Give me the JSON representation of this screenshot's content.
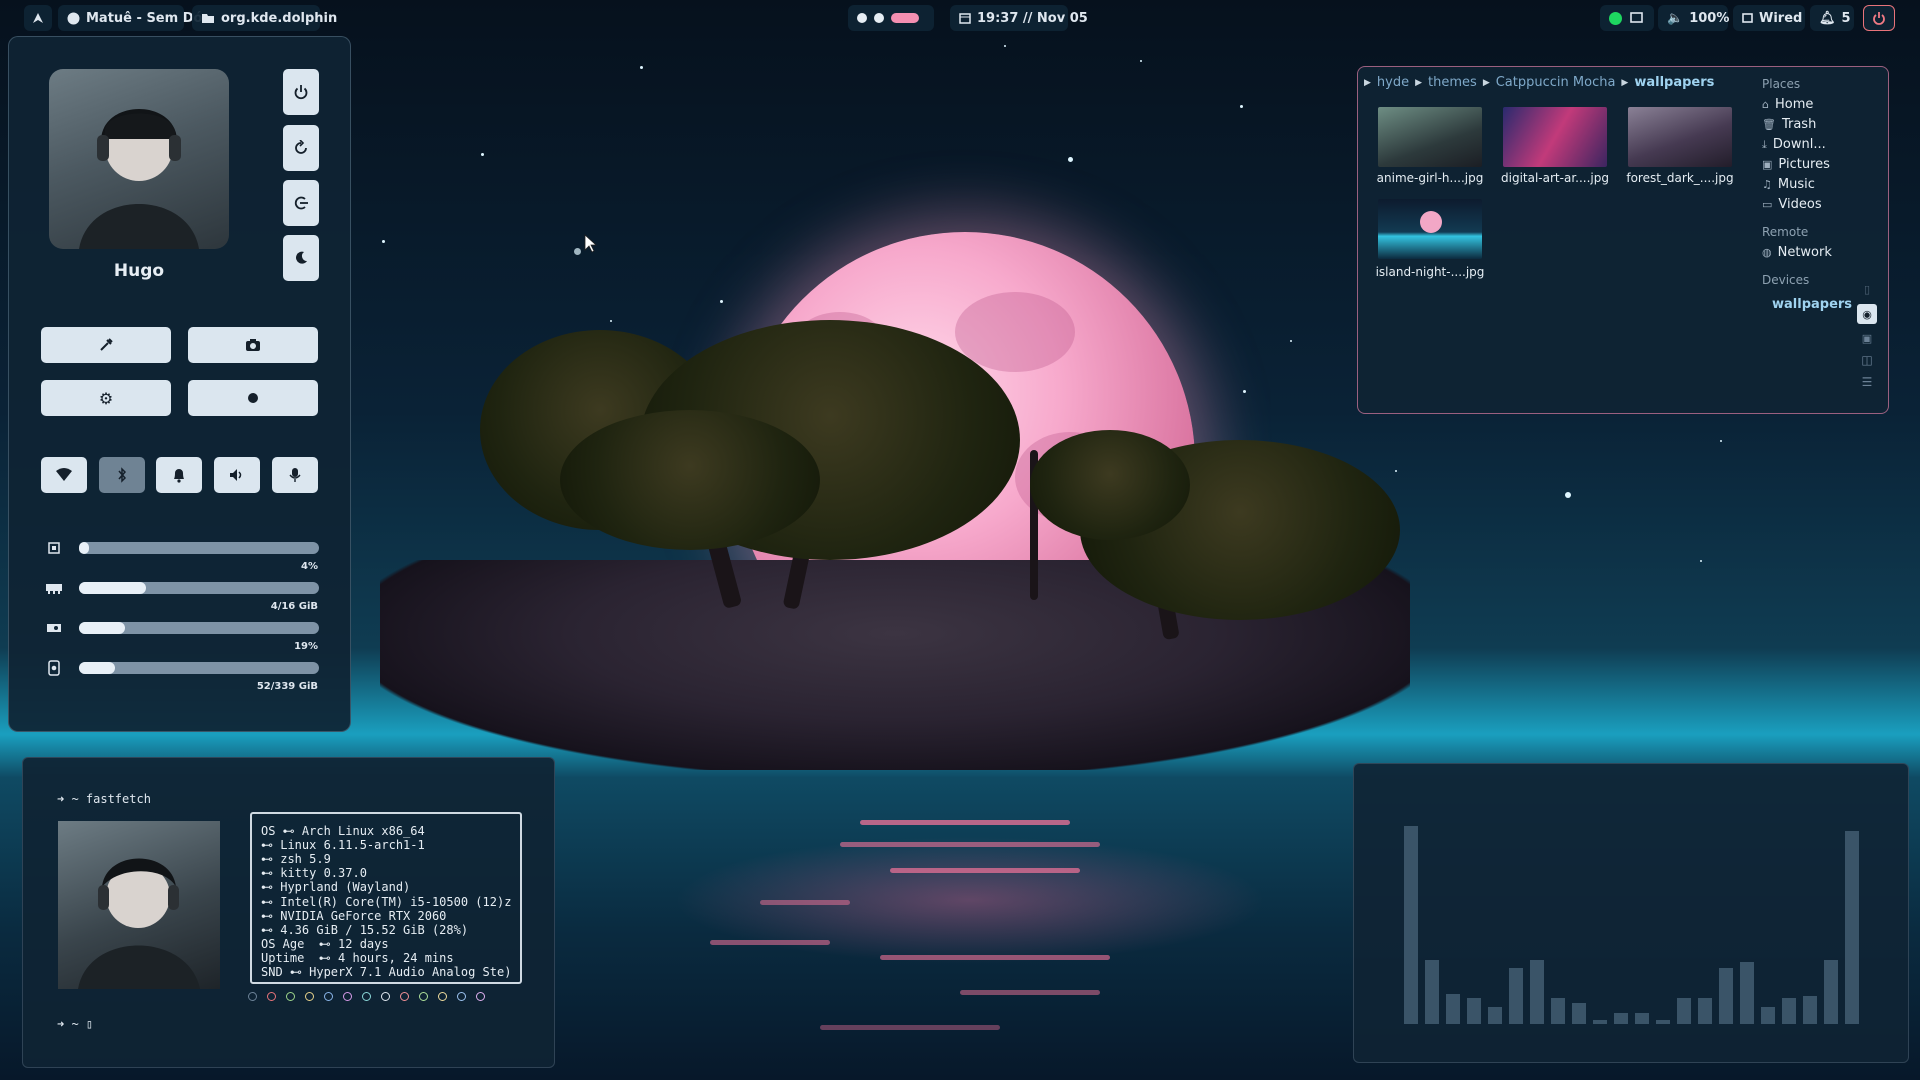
{
  "topbar": {
    "launcher_icon": "arch-launcher-icon",
    "window_title": "Matuê - Sem Dó",
    "app_id": "org.kde.dolphin",
    "clock": "19:37 // Nov 05",
    "volume": "100%",
    "network": "Wired",
    "notifications": "5"
  },
  "control_center": {
    "username": "Hugo",
    "side_buttons": [
      "power-icon",
      "restart-icon",
      "logout-icon",
      "moon-icon"
    ],
    "tool_buttons": [
      "color-picker-icon",
      "camera-icon",
      "settings-icon",
      "record-icon"
    ],
    "toggles": [
      "wifi-icon",
      "bluetooth-icon",
      "bell-icon",
      "volume-icon",
      "microphone-icon"
    ],
    "stats": [
      {
        "icon": "cpu-icon",
        "label": "4%",
        "fraction": 0.04
      },
      {
        "icon": "ram-icon",
        "label": "4/16 GiB",
        "fraction": 0.28
      },
      {
        "icon": "gpu-icon",
        "label": "19%",
        "fraction": 0.19
      },
      {
        "icon": "disk-icon",
        "label": "52/339 GiB",
        "fraction": 0.15
      }
    ]
  },
  "dolphin": {
    "breadcrumb": [
      "hyde",
      "themes",
      "Catppuccin Mocha",
      "wallpapers"
    ],
    "files": [
      "anime-girl-h....jpg",
      "digital-art-ar....jpg",
      "forest_dark_....jpg",
      "island-night-....jpg"
    ],
    "places_header": "Places",
    "places": [
      "Home",
      "Trash",
      "Downl...",
      "Pictures",
      "Music",
      "Videos"
    ],
    "remote_header": "Remote",
    "remote": [
      "Network"
    ],
    "devices_header": "Devices",
    "device_active": "wallpapers"
  },
  "terminal": {
    "prompt1": "➜  ~ fastfetch",
    "prompt2": "➜  ~ ▯",
    "fetch_lines": [
      "OS ⊷ Arch Linux x86_64",
      "⊷ Linux 6.11.5-arch1-1",
      "⊷ zsh 5.9",
      "⊷ kitty 0.37.0",
      "⊷ Hyprland (Wayland)",
      "⊷ Intel(R) Core(TM) i5-10500 (12)z",
      "⊷ NVIDIA GeForce RTX 2060",
      "⊷ 4.36 GiB / 15.52 GiB (28%)",
      "OS Age  ⊷ 12 days",
      "Uptime  ⊷ 4 hours, 24 mins",
      "SND ⊷ HyperX 7.1 Audio Analog Ste)"
    ]
  },
  "visualizer": {
    "levels": [
      0.92,
      0.3,
      0.14,
      0.12,
      0.08,
      0.26,
      0.3,
      0.12,
      0.1,
      0.02,
      0.05,
      0.05,
      0.02,
      0.12,
      0.12,
      0.26,
      0.29,
      0.08,
      0.12,
      0.13,
      0.3,
      0.9
    ]
  }
}
